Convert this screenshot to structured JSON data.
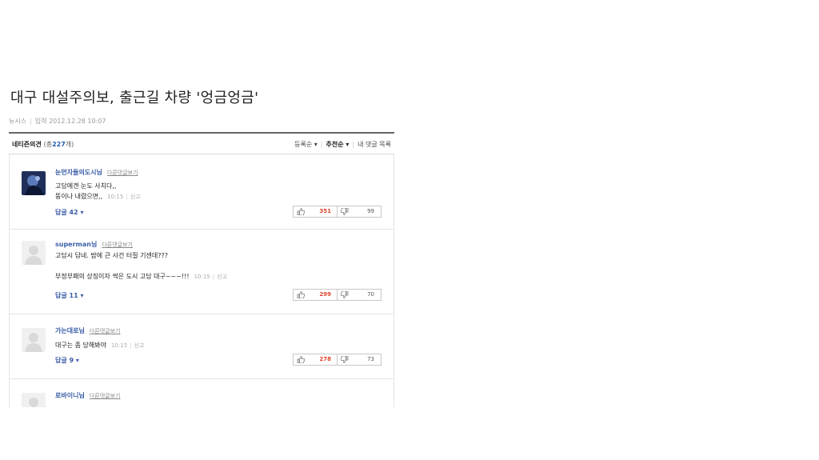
{
  "article": {
    "title": "대구 대설주의보, 출근길 차량 '엉금엉금'",
    "source": "뉴시스",
    "input_label": "입력",
    "date": "2012.12.28 10:07"
  },
  "comments_header": {
    "title": "네티즌의견",
    "count_open": "(총",
    "count": "227",
    "count_close": "개)",
    "sort": [
      "등록순",
      "추천순",
      "내 댓글 목록"
    ]
  },
  "comments": [
    {
      "author": "눈먼자들의도시님",
      "other_link": "다른댓글보기",
      "lines": [
        "고담에겐 눈도 사치다,,",
        "뚱이나 내렸으면,,"
      ],
      "time": "10:15",
      "report": "신고",
      "replies": "답글 42",
      "likes": "351",
      "dislikes": "99",
      "avatar": "photo"
    },
    {
      "author": "superman님",
      "other_link": "다른댓글보기",
      "lines": [
        "고담시 답네. 밤에 큰 사건 터질 기센데???",
        "",
        "부정부패의 상징이자 썩은 도시 고담 대구~~~!!!"
      ],
      "time": "10:15",
      "report": "신고",
      "replies": "답글 11",
      "likes": "299",
      "dislikes": "70",
      "avatar": "default"
    },
    {
      "author": "가는대로님",
      "other_link": "다른댓글보기",
      "lines": [
        "대구는 좀 당해봐야"
      ],
      "time": "10:15",
      "report": "신고",
      "replies": "답글 9",
      "likes": "278",
      "dislikes": "73",
      "avatar": "default"
    },
    {
      "author": "로바이니님",
      "other_link": "다른댓글보기",
      "lines": [],
      "avatar": "default"
    }
  ],
  "icons": {
    "like": "thumbs-up-icon",
    "dislike": "thumbs-down-icon",
    "caret": "caret-down-icon",
    "default_avatar": "user-silhouette-icon"
  },
  "colors": {
    "link_blue": "#3b5ea8",
    "like_red": "#e0422b",
    "border": "#e4e4e4"
  }
}
